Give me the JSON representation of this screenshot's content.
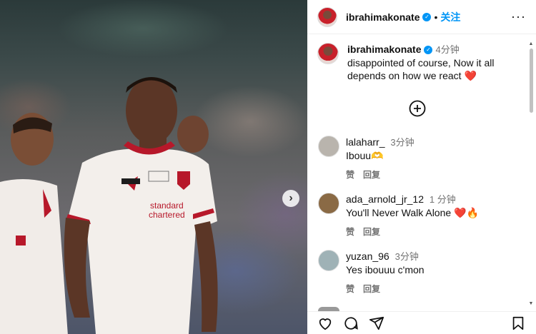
{
  "post": {
    "username": "ibrahimakonate",
    "follow_label": "关注",
    "separator": "•",
    "more_label": "···"
  },
  "caption": {
    "username": "ibrahimakonate",
    "time": "4分钟",
    "text": "disappointed of course, Now it all depends on how we react",
    "emoji": "❤️"
  },
  "comments": [
    {
      "username": "lalaharr_",
      "time": "3分钟",
      "text": "Ibouu🫶",
      "like_label": "赞",
      "reply_label": "回复",
      "avatar_color": "#b9b4ad"
    },
    {
      "username": "ada_arnold_jr_12",
      "time": "1 分钟",
      "text": "You'll Never Walk Alone ❤️🔥",
      "like_label": "赞",
      "reply_label": "回复",
      "avatar_color": "#8a6a45"
    },
    {
      "username": "yuzan_96",
      "time": "3分钟",
      "text": "Yes ibouuu c'mon",
      "like_label": "赞",
      "reply_label": "回复",
      "avatar_color": "#9fb2b6"
    }
  ],
  "icons": [
    "more-icon",
    "verified-icon",
    "add-comment-icon",
    "next-image-icon",
    "heart-icon",
    "comment-icon",
    "share-icon",
    "bookmark-icon"
  ],
  "colors": {
    "accent": "#0095f6",
    "heart": "#e3122c",
    "text": "#111111",
    "muted": "#737373"
  },
  "jersey": {
    "brand_line1": "standard",
    "brand_line2": "chartered"
  }
}
